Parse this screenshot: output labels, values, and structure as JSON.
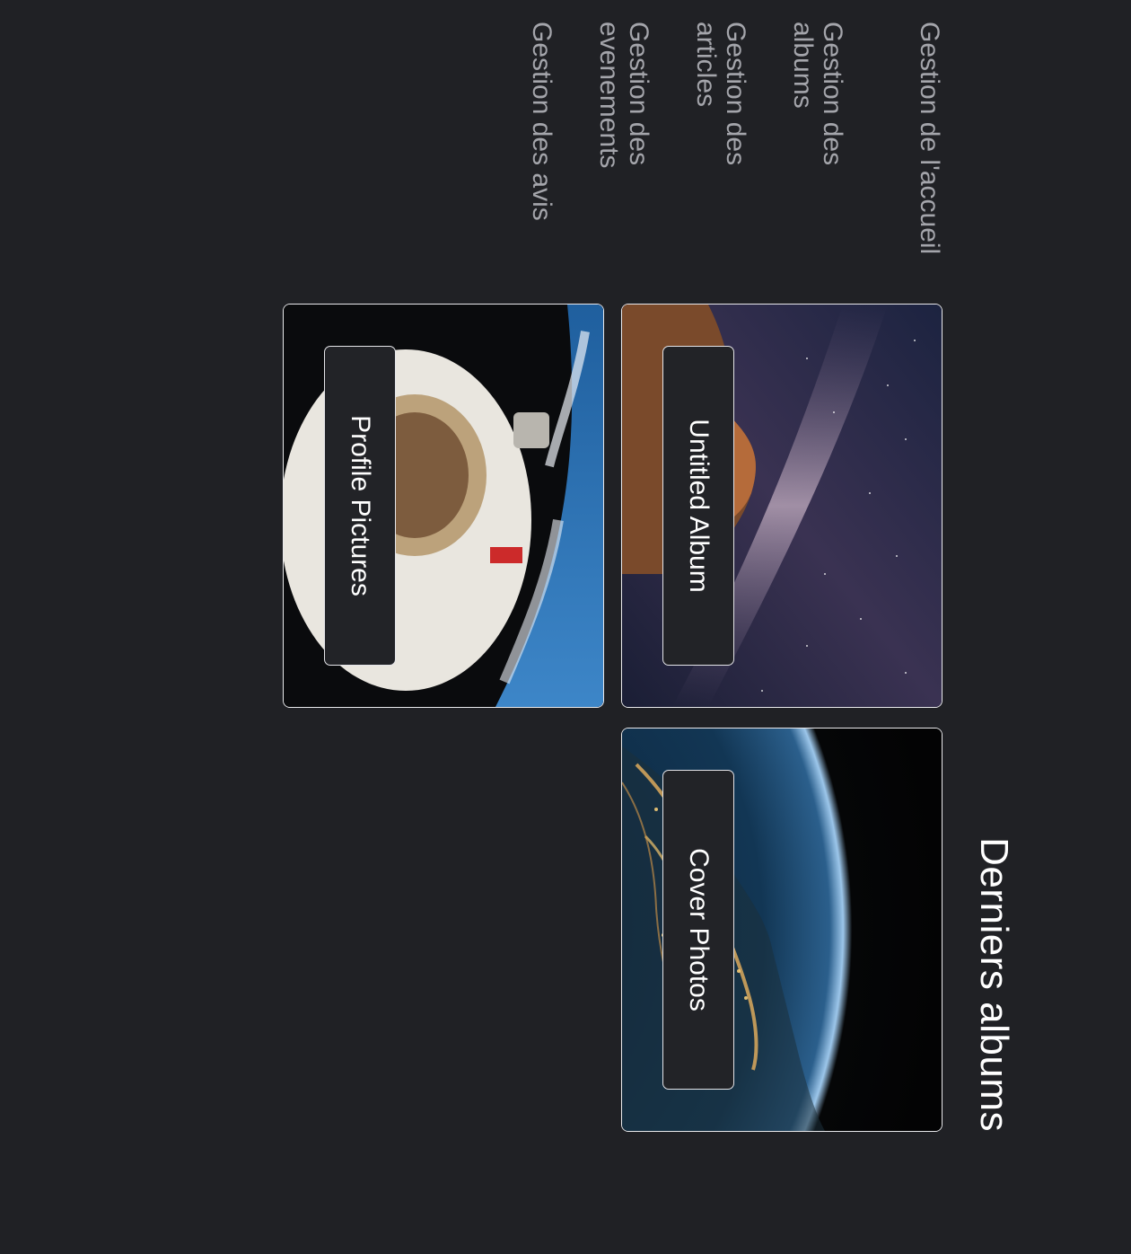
{
  "sidebar": {
    "items": [
      {
        "label": "Gestion de l'accueil"
      },
      {
        "label": "Gestion des albums"
      },
      {
        "label": "Gestion des articles"
      },
      {
        "label": "Gestion des evenements"
      },
      {
        "label": "Gestion des avis"
      }
    ]
  },
  "main": {
    "title": "Derniers albums",
    "albums": [
      {
        "name": "Cover Photos",
        "image": "earth-at-night-from-space"
      },
      {
        "name": "Untitled Album",
        "image": "milky-way-over-rock"
      },
      {
        "name": "Profile Pictures",
        "image": "astronaut-spacewalk"
      }
    ]
  },
  "colors": {
    "background": "#202125",
    "nav_text": "#a4a5ab",
    "title_text": "#ffffff",
    "card_border": "#e9e9ec",
    "label_bg": "#222327"
  }
}
